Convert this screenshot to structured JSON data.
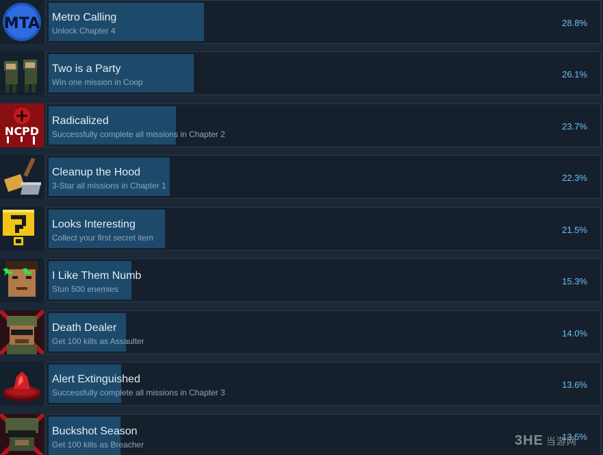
{
  "achievements": [
    {
      "title": "Metro Calling",
      "description": "Unlock Chapter 4",
      "percent": "28.8%",
      "percent_value": 28.8,
      "icon": "mta-badge-icon"
    },
    {
      "title": "Two is a Party",
      "description": "Win one mission in Coop",
      "percent": "26.1%",
      "percent_value": 26.1,
      "icon": "two-soldiers-icon"
    },
    {
      "title": "Radicalized",
      "description": "Successfully complete all missions in Chapter 2",
      "percent": "23.7%",
      "percent_value": 23.7,
      "icon": "ncpd-graffiti-icon"
    },
    {
      "title": "Cleanup the Hood",
      "description": "3-Star all missions in Chapter 1",
      "percent": "22.3%",
      "percent_value": 22.3,
      "icon": "broom-dustpan-icon"
    },
    {
      "title": "Looks Interesting",
      "description": "Collect your first secret item",
      "percent": "21.5%",
      "percent_value": 21.5,
      "icon": "question-mark-icon"
    },
    {
      "title": "I Like Them Numb",
      "description": "Stun 500 enemies",
      "percent": "15.3%",
      "percent_value": 15.3,
      "icon": "dazed-face-icon"
    },
    {
      "title": "Death Dealer",
      "description": "Get 100 kills as Assaulter",
      "percent": "14.0%",
      "percent_value": 14.0,
      "icon": "assaulter-soldier-icon"
    },
    {
      "title": "Alert Extinguished",
      "description": "Successfully complete all missions in Chapter 3",
      "percent": "13.6%",
      "percent_value": 13.6,
      "icon": "alarm-light-icon"
    },
    {
      "title": "Buckshot Season",
      "description": "Get 100 kills as Breacher",
      "percent": "13.5%",
      "percent_value": 13.5,
      "icon": "breacher-soldier-icon"
    }
  ],
  "watermark": {
    "logo": "3HE",
    "text": "当游网"
  },
  "colors": {
    "background": "#1b2838",
    "bar": "#1d4a6b",
    "percent": "#66c0f4",
    "title": "#e6edf3",
    "description": "#8ea7bc"
  }
}
